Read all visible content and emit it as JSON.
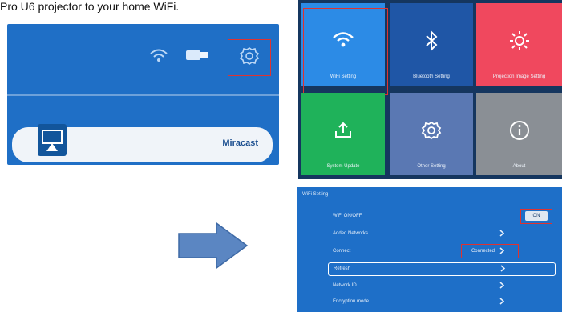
{
  "caption": "Pro U6 projector to your home WiFi.",
  "home_screen": {
    "cast_label": "Miracast",
    "icons": [
      "wifi-icon",
      "hdmi-dongle-icon",
      "gear-icon",
      "screen-cast-icon"
    ]
  },
  "tile_menu": {
    "tiles": [
      {
        "label": "WiFi Setting",
        "icon": "wifi-icon",
        "color": "#2c8be6"
      },
      {
        "label": "Bluetooth Setting",
        "icon": "bluetooth-icon",
        "color": "#1f56a6"
      },
      {
        "label": "Projection Image Setting",
        "icon": "brightness-icon",
        "color": "#f0485e"
      },
      {
        "label": "System Update",
        "icon": "upload-icon",
        "color": "#1fb25a"
      },
      {
        "label": "Other Setting",
        "icon": "gear-icon",
        "color": "#5a78b3"
      },
      {
        "label": "About",
        "icon": "info-icon",
        "color": "#8a8f95"
      }
    ]
  },
  "wifi_settings": {
    "title": "WiFi Setting",
    "rows": [
      {
        "label": "WiFi ON/OFF",
        "value": "ON",
        "control": "toggle"
      },
      {
        "label": "Added Networks",
        "value": "",
        "control": "chevron"
      },
      {
        "label": "Connect",
        "value": "Connected",
        "control": "chevron"
      },
      {
        "label": "Refresh",
        "value": "",
        "control": "chevron"
      },
      {
        "label": "Network ID",
        "value": "",
        "control": "chevron"
      },
      {
        "label": "Encryption mode",
        "value": "",
        "control": "chevron"
      }
    ]
  },
  "colors": {
    "home_bg": "#1f6fc6",
    "menu_bg": "#15365f",
    "settings_bg": "#1e6fc8",
    "highlight": "#e0322f",
    "arrow": "#5b86c2"
  }
}
